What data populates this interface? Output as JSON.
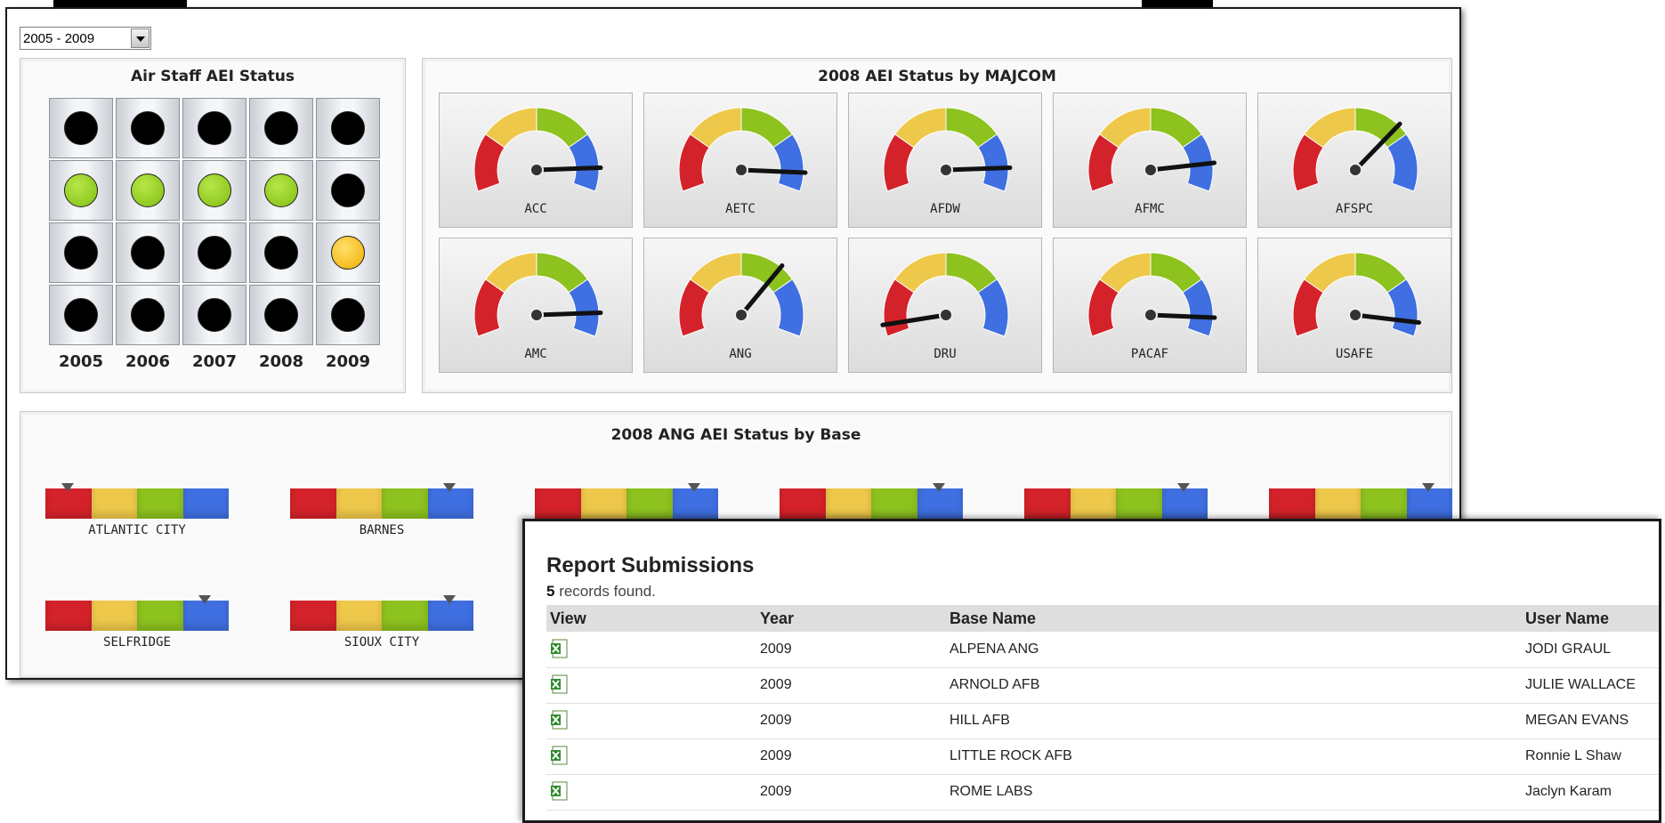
{
  "dashboard": {
    "year_range_select": "2005 - 2009",
    "air_staff": {
      "title": "Air Staff AEI Status",
      "years": [
        "2005",
        "2006",
        "2007",
        "2008",
        "2009"
      ],
      "status_grid": [
        [
          "off",
          "off",
          "off",
          "off",
          "off"
        ],
        [
          "green",
          "green",
          "green",
          "green",
          "off"
        ],
        [
          "off",
          "off",
          "off",
          "off",
          "yellow"
        ],
        [
          "off",
          "off",
          "off",
          "off",
          "off"
        ]
      ]
    },
    "majcom": {
      "title": "2008 AEI Status by MAJCOM",
      "gauges": [
        {
          "label": "ACC",
          "level": 0.9
        },
        {
          "label": "AETC",
          "level": 0.92
        },
        {
          "label": "AFDW",
          "level": 0.9
        },
        {
          "label": "AFMC",
          "level": 0.88
        },
        {
          "label": "AFSPC",
          "level": 0.7
        },
        {
          "label": "AMC",
          "level": 0.9
        },
        {
          "label": "ANG",
          "level": 0.68
        },
        {
          "label": "DRU",
          "level": 0.05
        },
        {
          "label": "PACAF",
          "level": 0.92
        },
        {
          "label": "USAFE",
          "level": 0.94
        }
      ]
    },
    "bases": {
      "title": "2008 ANG AEI Status by Base",
      "items": [
        {
          "label": "ATLANTIC CITY",
          "level": 0.12
        },
        {
          "label": "BARNES",
          "level": 0.87
        },
        {
          "label": "",
          "level": 0.87
        },
        {
          "label": "",
          "level": 0.87
        },
        {
          "label": "",
          "level": 0.87
        },
        {
          "label": "",
          "level": 0.87
        },
        {
          "label": "SELFRIDGE",
          "level": 0.87
        },
        {
          "label": "SIOUX CITY",
          "level": 0.87
        }
      ]
    }
  },
  "report": {
    "title": "Report Submissions",
    "count": "5",
    "count_suffix": " records found.",
    "columns": {
      "view": "View",
      "year": "Year",
      "base": "Base Name",
      "user": "User Name"
    },
    "rows": [
      {
        "year": "2009",
        "base": "ALPENA ANG",
        "user": "JODI GRAUL"
      },
      {
        "year": "2009",
        "base": "ARNOLD AFB",
        "user": "JULIE WALLACE"
      },
      {
        "year": "2009",
        "base": "HILL AFB",
        "user": "MEGAN EVANS"
      },
      {
        "year": "2009",
        "base": "LITTLE ROCK AFB",
        "user": "Ronnie L Shaw"
      },
      {
        "year": "2009",
        "base": "ROME LABS",
        "user": "Jaclyn Karam"
      }
    ]
  },
  "colors": {
    "red": "#d4222a",
    "yellow": "#eec84a",
    "green": "#8dc21f",
    "blue": "#3f6fe0"
  }
}
